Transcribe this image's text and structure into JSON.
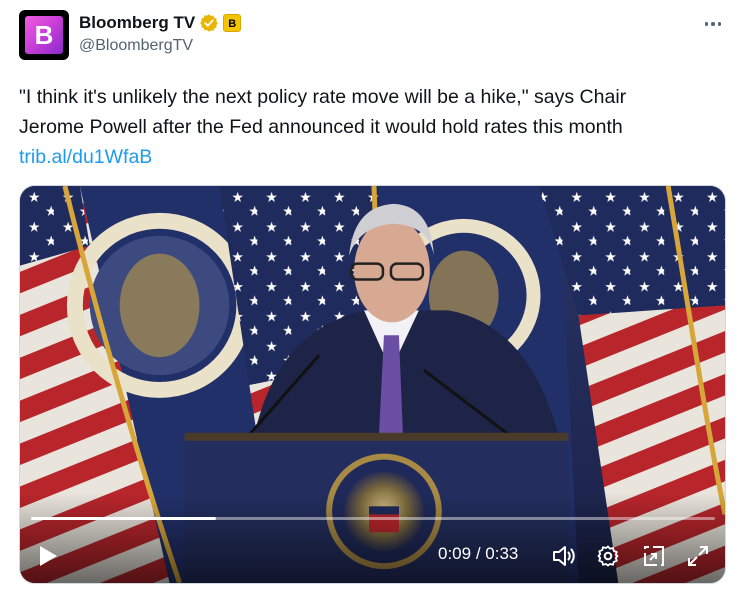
{
  "account": {
    "display_name": "Bloomberg TV",
    "handle": "@BloombergTV",
    "avatar_letter": "B",
    "affiliate_badge_letter": "B",
    "verified_color": "#e8b500",
    "avatar_color": "#d04bd9"
  },
  "tweet": {
    "line1": "\"I think it's unlikely the next policy rate move will be a hike,\" says Chair",
    "line2": "Jerome Powell after the Fed announced it would hold rates this month",
    "link": "trib.al/du1WfaB",
    "link_color": "#1d9bf0"
  },
  "video": {
    "current_time": "0:09",
    "separator": " / ",
    "duration": "0:33",
    "progress": 0.27,
    "controls": [
      "play-icon",
      "volume-icon",
      "settings-icon",
      "pop-out-icon",
      "fullscreen-icon"
    ]
  }
}
